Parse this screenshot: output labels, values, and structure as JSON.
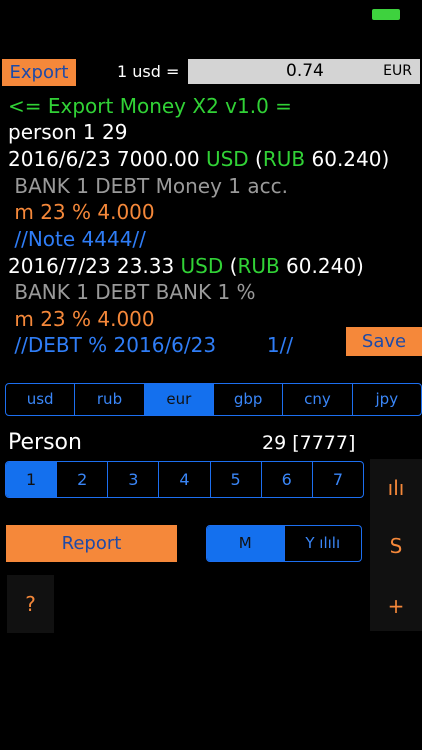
{
  "status": {
    "battery_color": "#3ed23e"
  },
  "toolbar": {
    "export_label": "Export",
    "rate_label": "1 usd =",
    "rate_value": "0.74",
    "rate_currency": "EUR"
  },
  "log": {
    "header": "<= Export Money X2 v1.0 =",
    "person_line": "person 1 29",
    "entries": [
      {
        "date_amount": "2016/6/23 7000.00 ",
        "currency": "USD",
        "paren_open": " (",
        "alt_currency": "RUB",
        "rate": " 60.240)",
        "account": " BANK 1 DEBT Money 1 acc.",
        "metric": " m 23 % 4.000",
        "note": " //Note 4444//"
      },
      {
        "date_amount": "2016/7/23 23.33 ",
        "currency": "USD",
        "paren_open": " (",
        "alt_currency": "RUB",
        "rate": " 60.240)",
        "account": " BANK 1 DEBT BANK 1 %",
        "metric": " m 23 % 4.000",
        "note": " //DEBT % 2016/6/23        1//"
      }
    ]
  },
  "save_label": "Save",
  "currencies": [
    "usd",
    "rub",
    "eur",
    "gbp",
    "cny",
    "jpy"
  ],
  "selected_currency": "eur",
  "person": {
    "label": "Person",
    "count": "29 [7777]"
  },
  "person_numbers": [
    "1",
    "2",
    "3",
    "4",
    "5",
    "6",
    "7"
  ],
  "selected_person": "1",
  "side": {
    "chart_label": "ılı",
    "sum_label": "S",
    "add_label": "+"
  },
  "report_label": "Report",
  "period": {
    "month_label": "M",
    "year_label": "Y ılılı",
    "selected": "M"
  },
  "help_label": "?",
  "colors": {
    "accent": "#f5883a",
    "segment_blue": "#1470ee",
    "green": "#31d236",
    "note_blue": "#2f7df6"
  }
}
